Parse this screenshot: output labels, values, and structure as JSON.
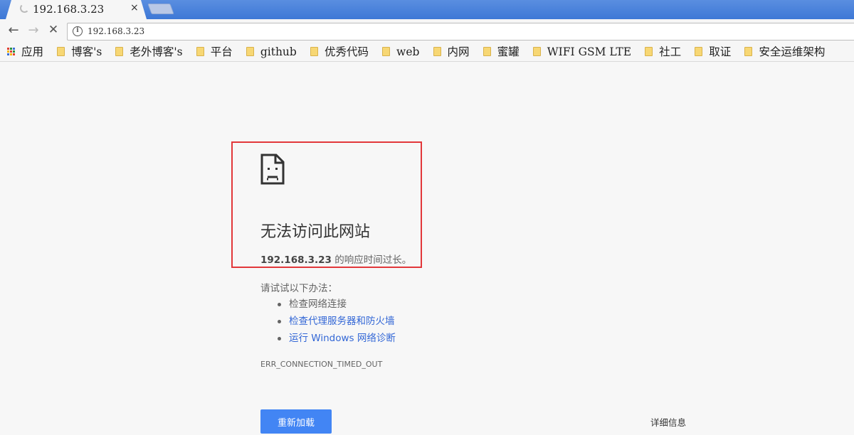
{
  "tab": {
    "title": "192.168.3.23",
    "close": "×"
  },
  "toolbar": {
    "back": "←",
    "forward": "→",
    "stop": "✕",
    "info": "i",
    "url": "192.168.3.23"
  },
  "bookmarks": {
    "apps": "应用",
    "items": [
      "博客's",
      "老外博客's",
      "平台",
      "github",
      "优秀代码",
      "web",
      "内网",
      "蜜罐",
      "WIFI GSM LTE",
      "社工",
      "取证",
      "安全运维架构"
    ]
  },
  "error": {
    "title": "无法访问此网站",
    "host": "192.168.3.23",
    "desc_suffix": " 的响应时间过长。",
    "suggest_head": "请试试以下办法：",
    "suggestions": [
      "检查网络连接",
      "检查代理服务器和防火墙",
      "运行 Windows 网络诊断"
    ],
    "code": "ERR_CONNECTION_TIMED_OUT",
    "reload_label": "重新加载",
    "details_label": "详细信息"
  },
  "colors": {
    "accent": "#4285f4",
    "link": "#3367d6",
    "highlight": "#e2373a"
  }
}
